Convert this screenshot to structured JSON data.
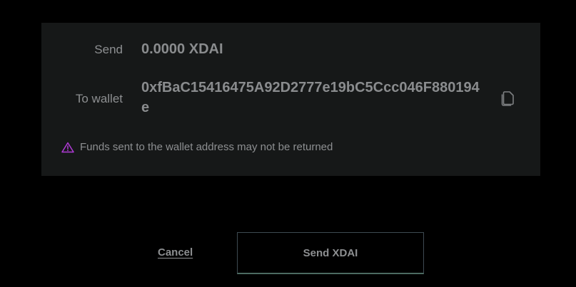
{
  "summary": {
    "send_label": "Send",
    "send_amount": "0.0000 XDAI",
    "wallet_label": "To wallet",
    "wallet_address": "0xfBaC15416475A92D2777e19bC5Ccc046F880194e",
    "copy_icon": "copy-icon"
  },
  "warning": {
    "icon": "warning-triangle-icon",
    "icon_color": "#b03ad6",
    "text": "Funds sent to the wallet address may not be returned"
  },
  "actions": {
    "cancel_label": "Cancel",
    "send_label": "Send XDAI"
  }
}
